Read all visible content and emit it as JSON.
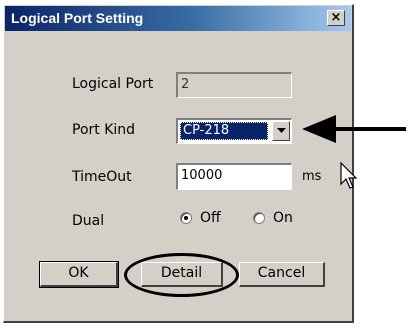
{
  "dialog": {
    "title": "Logical Port Setting",
    "close_label": "×"
  },
  "fields": {
    "logical_port_label": "Logical Port",
    "logical_port_value": "2",
    "port_kind_label": "Port Kind",
    "port_kind_value": "CP-218",
    "timeout_label": "TimeOut",
    "timeout_value": "10000",
    "timeout_unit": "ms",
    "dual_label": "Dual",
    "dual_off_label": "Off",
    "dual_on_label": "On",
    "dual_selected": "Off"
  },
  "buttons": {
    "ok": "OK",
    "detail": "Detail",
    "cancel": "Cancel"
  },
  "icons": {
    "dropdown": "chevron-down-icon",
    "annotation_arrow": "arrow-left-icon",
    "annotation_circle": "highlight-ellipse",
    "cursor": "mouse-cursor-icon"
  }
}
